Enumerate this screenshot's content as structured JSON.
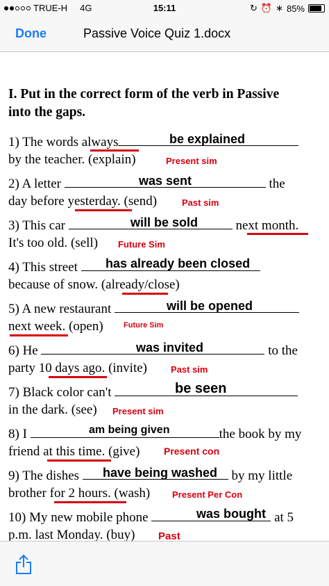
{
  "status": {
    "carrier": "TRUE-H",
    "network": "4G",
    "time": "15:11",
    "battery": "85%",
    "battery_level": 0.85
  },
  "nav": {
    "done": "Done",
    "title": "Passive Voice Quiz 1.docx"
  },
  "heading_line1": "I. Put in the correct form of the verb in Passive",
  "heading_line2": "into the gaps.",
  "questions": [
    {
      "a": "1) The words ",
      "b": "always",
      "c": "",
      "d": "by the teacher. (explain)",
      "ans": "be explained",
      "tense": "Present sim"
    },
    {
      "a": "2) A letter",
      "c": "the",
      "d1": "day before ",
      "d2": "yesterday",
      "d3": ". (send)",
      "ans": "was sent",
      "tense": "Past sim"
    },
    {
      "a": "3) This car",
      "c": "next month",
      "c2": ".",
      "d": "It's too old. (sell)",
      "ans": "will be sold",
      "tense": "Future Sim"
    },
    {
      "a": "4) This street",
      "d1": " because of snow. (",
      "d2": "already",
      "d3": "/close)",
      "ans": "has already been closed"
    },
    {
      "a": "5) A new restaurant",
      "d1": "next week",
      "d2": ". (open)",
      "ans": "will be opened",
      "tense": "Future Sim"
    },
    {
      "a": "6) He",
      "c": "to the",
      "d1": "party 1",
      "d2": "0 days ago",
      "d3": ". (invite)",
      "ans": "was invited",
      "tense": "Past sim"
    },
    {
      "a": "7) Black color can't",
      "d": "in the dark. (see)",
      "ans": "be seen",
      "tense": "Present sim"
    },
    {
      "a": "8) I",
      "c": "the book by my",
      "d1": "friend a",
      "d2": "t this time",
      "d3": ". (give)",
      "ans": "am being given",
      "tense": "Present con"
    },
    {
      "a": "9) The dishes",
      "c": "by my little",
      "d1": "brother ",
      "d2": "for 2 hours.",
      "d3": " (wash)",
      "ans": "have being washed",
      "tense": "Present Per Con"
    },
    {
      "a": "10) My new mobile phone",
      "c": "at 5",
      "d1": "p.m. ",
      "d2": "last Monday",
      "d3": ". (buy)",
      "ans": "was bought",
      "tense": "Past"
    }
  ]
}
